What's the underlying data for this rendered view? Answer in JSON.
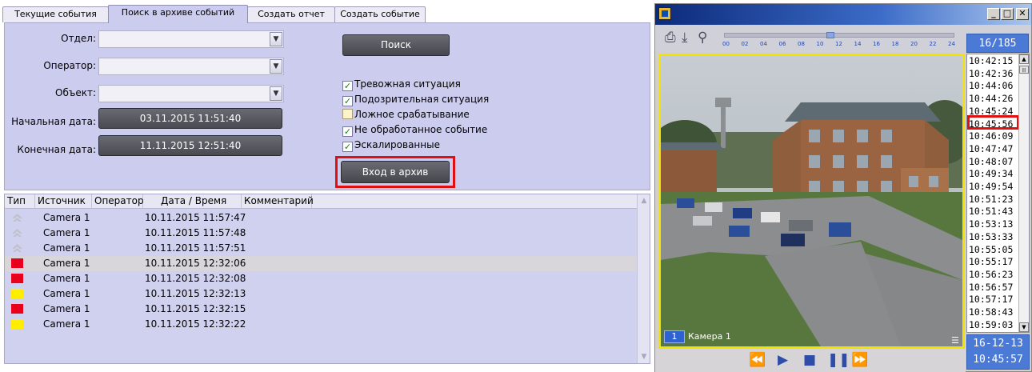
{
  "tabs": [
    {
      "label": "Текущие события"
    },
    {
      "label": "Поиск в архиве событий"
    },
    {
      "label": "Создать отчет"
    },
    {
      "label": "Создать событие"
    }
  ],
  "form": {
    "department_label": "Отдел:",
    "operator_label": "Оператор:",
    "object_label": "Объект:",
    "start_date_label": "Начальная дата:",
    "start_date_value": "03.11.2015 11:51:40",
    "end_date_label": "Конечная дата:",
    "end_date_value": "11.11.2015 12:51:40",
    "search_button": "Поиск",
    "archive_button": "Вход в архив"
  },
  "filters": [
    {
      "label": "Тревожная ситуация",
      "checked": true
    },
    {
      "label": "Подозрительная ситуация",
      "checked": true
    },
    {
      "label": "Ложное срабатывание",
      "checked": false
    },
    {
      "label": "Не обработанное событие",
      "checked": true
    },
    {
      "label": "Эскалированные",
      "checked": true
    }
  ],
  "table": {
    "headers": [
      "Тип",
      "Источник",
      "Оператор",
      "Дата / Время",
      "Комментарий"
    ],
    "rows": [
      {
        "type": "arrow",
        "source": "Camera 1",
        "datetime": "10.11.2015 11:57:47"
      },
      {
        "type": "arrow",
        "source": "Camera 1",
        "datetime": "10.11.2015 11:57:48"
      },
      {
        "type": "arrow",
        "source": "Camera 1",
        "datetime": "10.11.2015 11:57:51"
      },
      {
        "type": "red",
        "source": "Camera 1",
        "datetime": "10.11.2015 12:32:06"
      },
      {
        "type": "red",
        "source": "Camera 1",
        "datetime": "10.11.2015 12:32:08"
      },
      {
        "type": "yellow",
        "source": "Camera 1",
        "datetime": "10.11.2015 12:32:13"
      },
      {
        "type": "red",
        "source": "Camera 1",
        "datetime": "10.11.2015 12:32:15"
      },
      {
        "type": "yellow",
        "source": "Camera 1",
        "datetime": "10.11.2015 12:32:22"
      }
    ],
    "selected_row": 3
  },
  "player": {
    "counter": "16/185",
    "timeline_ticks": [
      "00",
      "02",
      "04",
      "06",
      "08",
      "10",
      "12",
      "14",
      "16",
      "18",
      "20",
      "22",
      "24"
    ],
    "camera_number": "1",
    "camera_name": "Камера 1",
    "times": [
      "10:42:15",
      "10:42:36",
      "10:44:06",
      "10:44:26",
      "10:45:24",
      "10:45:56",
      "10:46:09",
      "10:47:47",
      "10:48:07",
      "10:49:34",
      "10:49:54",
      "10:51:23",
      "10:51:43",
      "10:53:13",
      "10:53:33",
      "10:55:05",
      "10:55:17",
      "10:56:23",
      "10:56:57",
      "10:57:17",
      "10:58:43",
      "10:59:03"
    ],
    "selected_time_index": 5,
    "current_date": "16-12-13",
    "current_time": "10:45:57"
  },
  "colors": {
    "panel": "#ccccee",
    "alarm_red": "#e8001c",
    "alarm_yellow": "#ffee00",
    "highlight": "#e01010"
  }
}
